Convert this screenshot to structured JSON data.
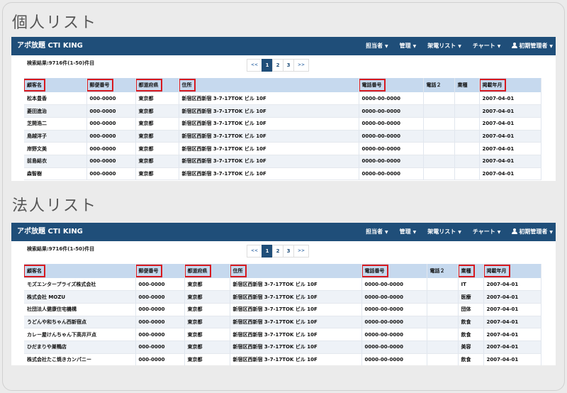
{
  "colors": {
    "navbar": "#1f4e79",
    "highlight": "#d7191f",
    "header_row": "#c6d9ee"
  },
  "navbar": {
    "brand": "アポ放題 CTI KING",
    "items": [
      "担当者",
      "管理",
      "架電リスト",
      "チャート"
    ],
    "user": "初期管理者",
    "caret": "▼",
    "user_icon": "user-icon"
  },
  "pager": {
    "prev": "<<",
    "pages": [
      "1",
      "2",
      "3"
    ],
    "next": ">>",
    "active": "1"
  },
  "individual": {
    "title": "個人リスト",
    "result_count": "検索結果:9716件(1-50)件目",
    "columns": [
      {
        "label": "顧客名",
        "highlight": true
      },
      {
        "label": "郵便番号",
        "highlight": true
      },
      {
        "label": "都道府県",
        "highlight": true
      },
      {
        "label": "住所",
        "highlight": true
      },
      {
        "label": "電話番号",
        "highlight": true
      },
      {
        "label": "電話２",
        "highlight": false
      },
      {
        "label": "業種",
        "highlight": false
      },
      {
        "label": "掲載年月",
        "highlight": true
      }
    ],
    "rows": [
      [
        "松本豊香",
        "000-0000",
        "東京都",
        "新宿区西新宿 3-7-17TOK ビル 10F",
        "0000-00-0000",
        "",
        "",
        "2007-04-01"
      ],
      [
        "菱田進治",
        "000-0000",
        "東京都",
        "新宿区西新宿 3-7-17TOK ビル 10F",
        "0000-00-0000",
        "",
        "",
        "2007-04-01"
      ],
      [
        "芝開浩二",
        "000-0000",
        "東京都",
        "新宿区西新宿 3-7-17TOK ビル 10F",
        "0000-00-0000",
        "",
        "",
        "2007-04-01"
      ],
      [
        "鳥越洋子",
        "000-0000",
        "東京都",
        "新宿区西新宿 3-7-17TOK ビル 10F",
        "0000-00-0000",
        "",
        "",
        "2007-04-01"
      ],
      [
        "岸野文美",
        "000-0000",
        "東京都",
        "新宿区西新宿 3-7-17TOK ビル 10F",
        "0000-00-0000",
        "",
        "",
        "2007-04-01"
      ],
      [
        "前島結衣",
        "000-0000",
        "東京都",
        "新宿区西新宿 3-7-17TOK ビル 10F",
        "0000-00-0000",
        "",
        "",
        "2007-04-01"
      ],
      [
        "森智樹",
        "000-0000",
        "東京都",
        "新宿区西新宿 3-7-17TOK ビル 10F",
        "0000-00-0000",
        "",
        "",
        "2007-04-01"
      ]
    ]
  },
  "corporate": {
    "title": "法人リスト",
    "result_count": "検索結果:9716件(1-50)件目",
    "columns": [
      {
        "label": "顧客名",
        "highlight": true
      },
      {
        "label": "郵便番号",
        "highlight": true
      },
      {
        "label": "都道府県",
        "highlight": true
      },
      {
        "label": "住所",
        "highlight": true
      },
      {
        "label": "電話番号",
        "highlight": true
      },
      {
        "label": "電話２",
        "highlight": false
      },
      {
        "label": "業種",
        "highlight": true
      },
      {
        "label": "掲載年月",
        "highlight": true
      }
    ],
    "rows": [
      [
        "モズエンタープライズ株式会社",
        "000-0000",
        "東京都",
        "新宿区西新宿 3-7-17TOK ビル 10F",
        "0000-00-0000",
        "",
        "IT",
        "2007-04-01"
      ],
      [
        "株式会社 MOZU",
        "000-0000",
        "東京都",
        "新宿区西新宿 3-7-17TOK ビル 10F",
        "0000-00-0000",
        "",
        "医療",
        "2007-04-01"
      ],
      [
        "社団法人健康住宅機構",
        "000-0000",
        "東京都",
        "新宿区西新宿 3-7-17TOK ビル 10F",
        "0000-00-0000",
        "",
        "団体",
        "2007-04-01"
      ],
      [
        "うどんや和ちゃん西新宿点",
        "000-0000",
        "東京都",
        "新宿区西新宿 3-7-17TOK ビル 10F",
        "0000-00-0000",
        "",
        "飲食",
        "2007-04-01"
      ],
      [
        "カレー屋けんちゃん下高井戸点",
        "000-0000",
        "東京都",
        "新宿区西新宿 3-7-17TOK ビル 10F",
        "0000-00-0000",
        "",
        "飲食",
        "2007-04-01"
      ],
      [
        "ひだまりや巣鴨店",
        "000-0000",
        "東京都",
        "新宿区西新宿 3-7-17TOK ビル 10F",
        "0000-00-0000",
        "",
        "美容",
        "2007-04-01"
      ],
      [
        "株式会社たこ焼きカンパニー",
        "000-0000",
        "東京都",
        "新宿区西新宿 3-7-17TOK ビル 10F",
        "0000-00-0000",
        "",
        "飲食",
        "2007-04-01"
      ]
    ]
  }
}
